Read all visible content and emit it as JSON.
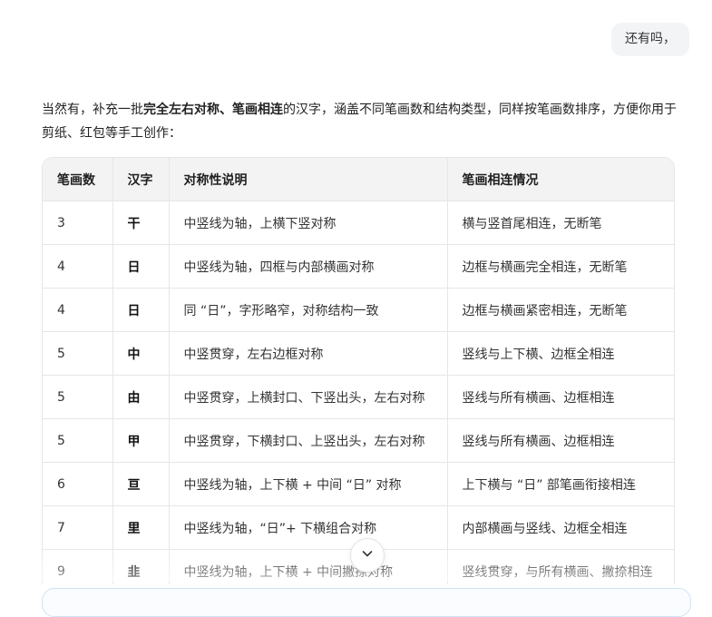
{
  "user_message": "还有吗，",
  "intro": {
    "before": "当然有，补充一批",
    "bold": "完全左右对称、笔画相连",
    "after": "的汉字，涵盖不同笔画数和结构类型，同样按笔画数排序，方便你用于剪纸、红包等手工创作："
  },
  "table": {
    "headers": [
      "笔画数",
      "汉字",
      "对称性说明",
      "笔画相连情况"
    ],
    "rows": [
      [
        "3",
        "干",
        "中竖线为轴，上横下竖对称",
        "横与竖首尾相连，无断笔"
      ],
      [
        "4",
        "日",
        "中竖线为轴，四框与内部横画对称",
        "边框与横画完全相连，无断笔"
      ],
      [
        "4",
        "日",
        "同 “日”，字形略窄，对称结构一致",
        "边框与横画紧密相连，无断笔"
      ],
      [
        "5",
        "中",
        "中竖贯穿，左右边框对称",
        "竖线与上下横、边框全相连"
      ],
      [
        "5",
        "由",
        "中竖贯穿，上横封口、下竖出头，左右对称",
        "竖线与所有横画、边框相连"
      ],
      [
        "5",
        "甲",
        "中竖贯穿，下横封口、上竖出头，左右对称",
        "竖线与所有横画、边框相连"
      ],
      [
        "6",
        "亘",
        "中竖线为轴，上下横 + 中间 “日” 对称",
        "上下横与 “日” 部笔画衔接相连"
      ],
      [
        "7",
        "里",
        "中竖线为轴，“日”+ 下横组合对称",
        "内部横画与竖线、边框全相连"
      ],
      [
        "9",
        "韭",
        "中竖线为轴，上下横 + 中间撇捺对称",
        "竖线贯穿，与所有横画、撇捺相连"
      ]
    ]
  },
  "icons": {
    "scroll_down": "chevron-down-icon"
  }
}
